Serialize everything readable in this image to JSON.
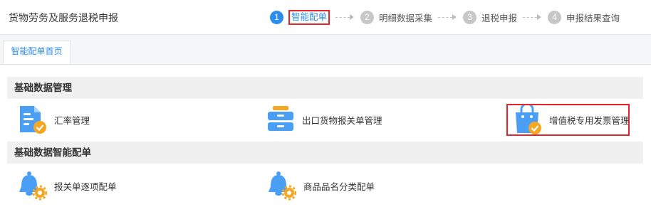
{
  "app_title": "货物劳务及服务退税申报",
  "steps": [
    {
      "num": "1",
      "label": "智能配单",
      "active": true
    },
    {
      "num": "2",
      "label": "明细数据采集",
      "active": false
    },
    {
      "num": "3",
      "label": "退税申报",
      "active": false
    },
    {
      "num": "4",
      "label": "申报结果查询",
      "active": false
    }
  ],
  "tab": {
    "label": "智能配单首页"
  },
  "sections": [
    {
      "title": "基础数据管理",
      "items": [
        {
          "label": "汇率管理",
          "icon": "document-check-icon"
        },
        {
          "label": "出口货物报关单管理",
          "icon": "tray-stack-icon"
        },
        {
          "label": "增值税专用发票管理",
          "icon": "shopping-bag-check-icon"
        }
      ]
    },
    {
      "title": "基础数据智能配单",
      "items": [
        {
          "label": "报关单逐项配单",
          "icon": "bell-gear-icon"
        },
        {
          "label": "商品品名分类配单",
          "icon": "bell-gear-icon"
        }
      ]
    }
  ],
  "colors": {
    "accent": "#2d8cf0",
    "highlight": "#e0262b",
    "icon_orange": "#f5a623",
    "icon_blue": "#4a9ff5"
  }
}
